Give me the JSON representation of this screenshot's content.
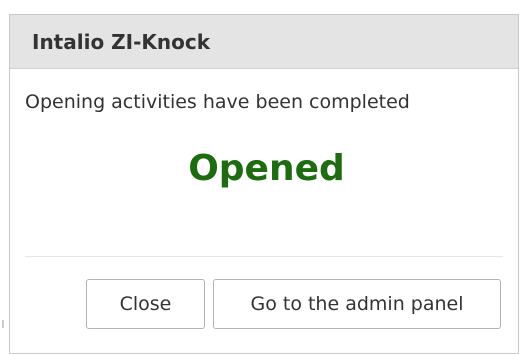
{
  "dialog": {
    "title": "Intalio ZI-Knock",
    "message": "Opening activities have been completed",
    "status_text": "Opened",
    "status_color": "#1e6b12",
    "buttons": {
      "close_label": "Close",
      "admin_label": "Go to the admin panel"
    }
  }
}
